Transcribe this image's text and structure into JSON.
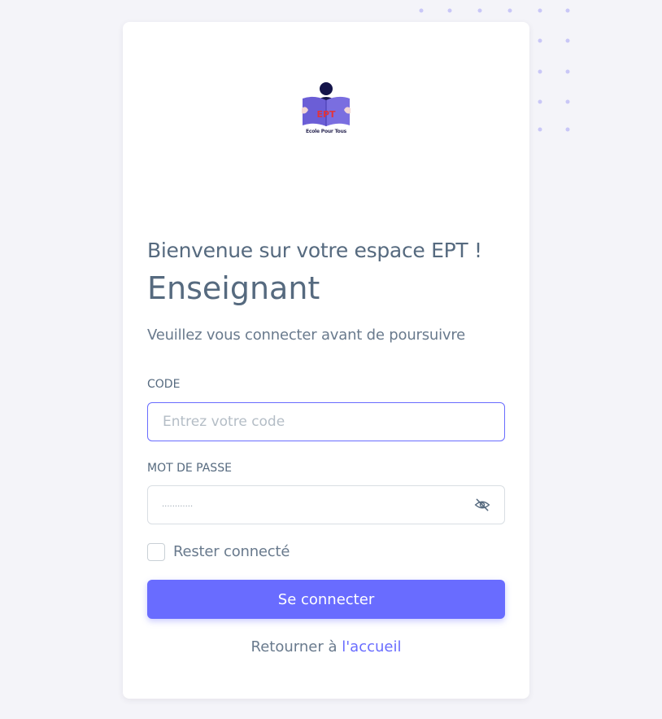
{
  "colors": {
    "background": "#f4f4f9",
    "card": "#ffffff",
    "primary": "#696cff",
    "text": "#566a7f",
    "muted_text": "#697a8d",
    "placeholder": "#b4bdc6",
    "dots": "#c9c7f7"
  },
  "logo": {
    "badge": "EPT",
    "tagline": "Ecole Pour Tous",
    "icon": "reading-person-logo"
  },
  "header": {
    "welcome": "Bienvenue sur votre espace EPT !",
    "role": "Enseignant",
    "subtitle": "Veuillez vous connecter avant de poursuivre"
  },
  "form": {
    "code_label": "CODE",
    "code_placeholder": "Entrez votre code",
    "code_value": "",
    "password_label": "MOT DE PASSE",
    "password_mask": "············",
    "password_toggle_icon": "eye-off-icon",
    "remember_label": "Rester connecté",
    "remember_checked": false,
    "submit_label": "Se connecter"
  },
  "footer": {
    "back_prefix": "Retourner à ",
    "back_link": "l'accueil"
  }
}
